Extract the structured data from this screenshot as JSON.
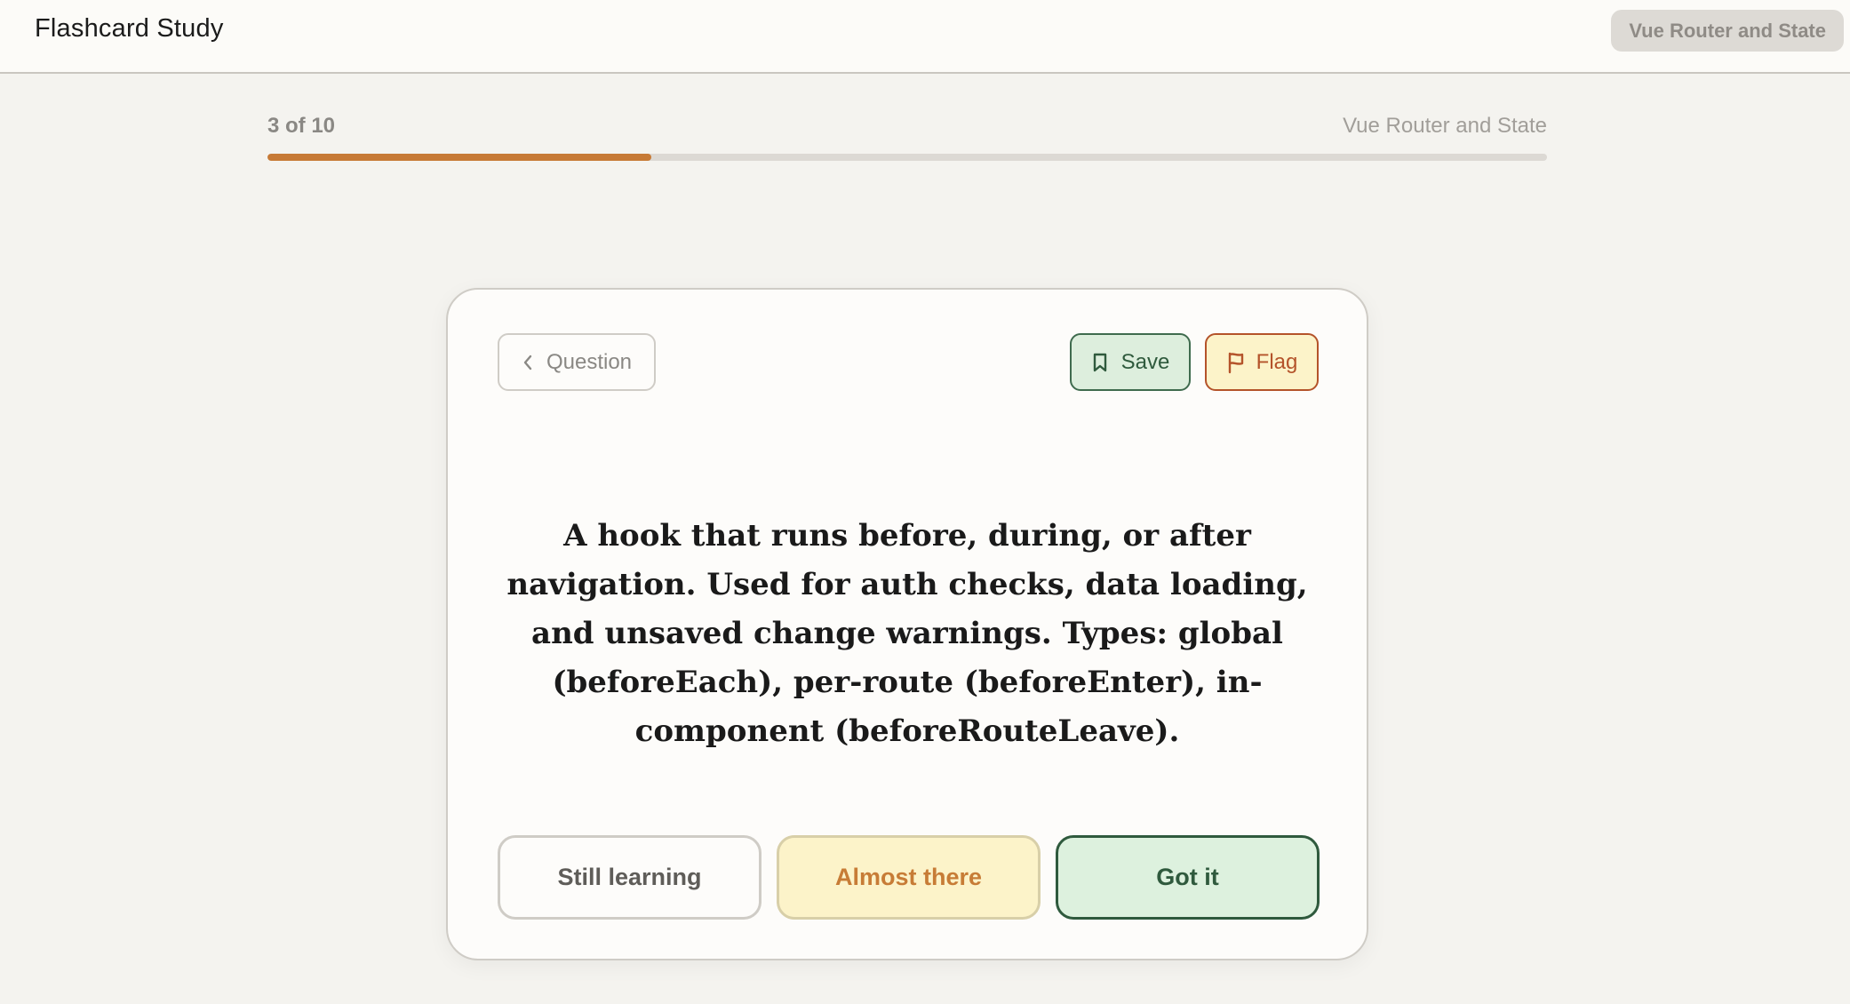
{
  "header": {
    "app_title": "Flashcard Study",
    "deck_badge": "Vue Router and State"
  },
  "progress": {
    "count_label": "3 of 10",
    "deck_name": "Vue Router and State",
    "fraction": 0.3,
    "fill_color": "#c77a36",
    "track_color": "#dcd9d4"
  },
  "card": {
    "back_button": {
      "label": "Question",
      "icon": "chevron-left-icon"
    },
    "save_button": {
      "label": "Save",
      "icon": "bookmark-icon"
    },
    "flag_button": {
      "label": "Flag",
      "icon": "flag-icon"
    },
    "answer": "A hook that runs before, during, or after navigation. Used for auth checks, data loading, and unsaved change warnings. Types: global (beforeEach), per-route (beforeEnter), in-component (beforeRouteLeave).",
    "ratings": {
      "still_learning": "Still learning",
      "almost_there": "Almost there",
      "got_it": "Got it"
    }
  },
  "colors": {
    "accent": "#c77a36",
    "save_green": "#2f5a3d",
    "flag_orange": "#b4532a"
  }
}
